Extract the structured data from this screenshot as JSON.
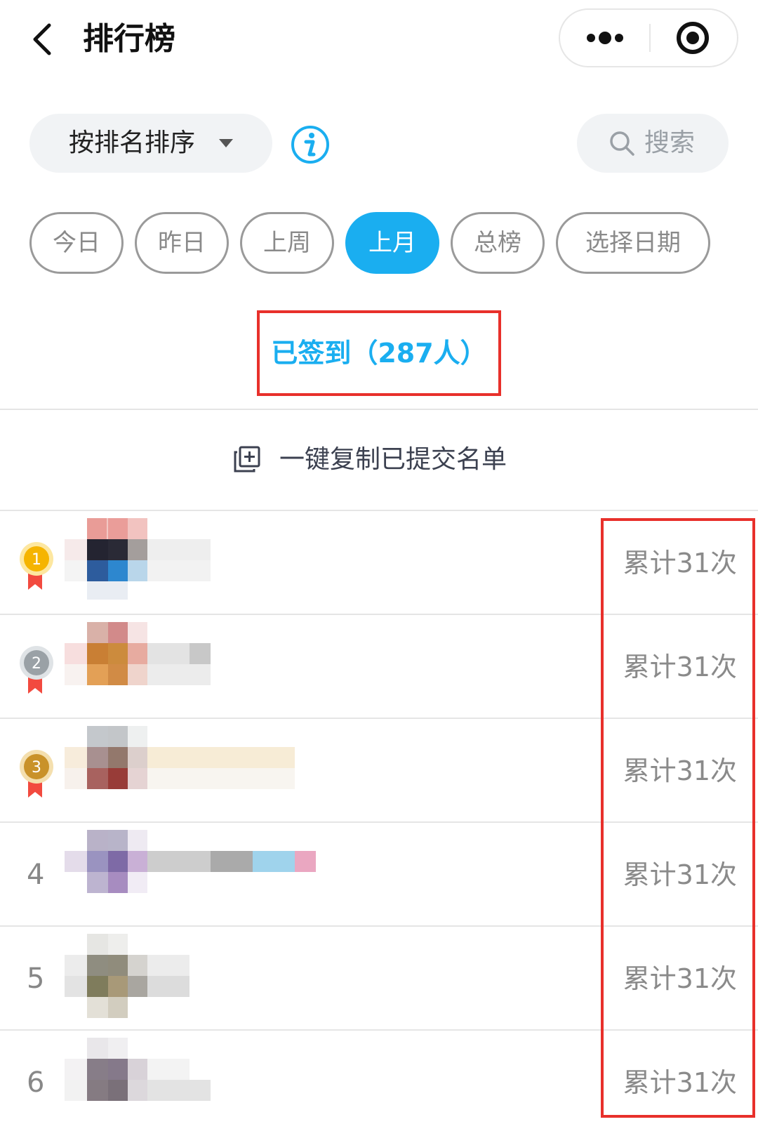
{
  "header": {
    "title": "排行榜"
  },
  "toolbar": {
    "sort_label": "按排名排序",
    "search_label": "搜索"
  },
  "filters": {
    "chips": [
      {
        "label": "今日",
        "active": false
      },
      {
        "label": "昨日",
        "active": false
      },
      {
        "label": "上周",
        "active": false
      },
      {
        "label": "上月",
        "active": true
      },
      {
        "label": "总榜",
        "active": false
      },
      {
        "label": "选择日期",
        "active": false
      }
    ]
  },
  "signed": {
    "text": "已签到（287人）"
  },
  "copy": {
    "label": "一键复制已提交名单"
  },
  "ranking": [
    {
      "rank": "1",
      "medal": "gold",
      "count": "累计31次"
    },
    {
      "rank": "2",
      "medal": "silver",
      "count": "累计31次"
    },
    {
      "rank": "3",
      "medal": "bronze",
      "count": "累计31次"
    },
    {
      "rank": "4",
      "medal": "",
      "count": "累计31次"
    },
    {
      "rank": "5",
      "medal": "",
      "count": "累计31次"
    },
    {
      "rank": "6",
      "medal": "",
      "count": "累计31次"
    }
  ],
  "colors": {
    "accent": "#1aaef0",
    "highlight": "#e8302b",
    "gold": "#f5b400",
    "silver": "#9aa1a6",
    "bronze": "#c9922a"
  }
}
